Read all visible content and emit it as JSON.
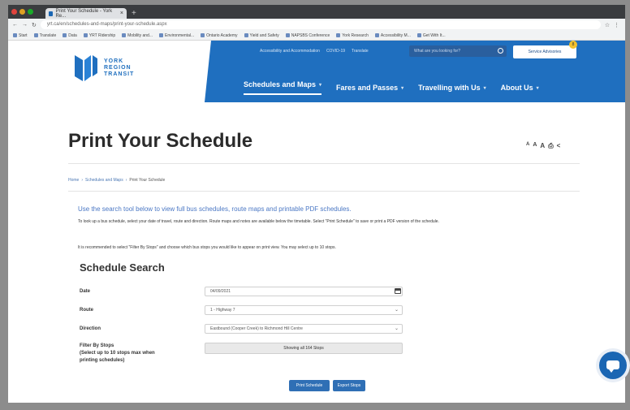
{
  "browser": {
    "tab_title": "Print Your Schedule - York Re...",
    "url": "yrt.ca/en/schedules-and-maps/print-your-schedule.aspx",
    "bookmarks": [
      "Start",
      "Translate",
      "Data",
      "YRT Ridership",
      "Mobility and...",
      "Environmental...",
      "Ontario Academy",
      "Yield and Safety",
      "NAPSBS Conference",
      "York Research",
      "Accessibility M...",
      "Get With It..."
    ]
  },
  "header": {
    "logo_lines": [
      "YORK",
      "REGION",
      "TRANSIT"
    ],
    "utility_links": [
      "Accessibility and Accommodation",
      "COVID-19",
      "Translate"
    ],
    "search_placeholder": "What are you looking for?",
    "service_button": "Service Advisories",
    "service_badge": "8",
    "nav": [
      {
        "label": "Schedules and Maps"
      },
      {
        "label": "Fares and Passes"
      },
      {
        "label": "Travelling with Us"
      },
      {
        "label": "About Us"
      }
    ]
  },
  "page": {
    "title": "Print Your Schedule",
    "tools": [
      "A",
      "A",
      "A",
      "⎙",
      "<"
    ],
    "breadcrumb": [
      "Home",
      "Schedules and Maps",
      "Print Your Schedule"
    ],
    "intro": "Use the search tool below to view full bus schedules, route maps and printable PDF schedules.",
    "para1": "To look up a bus schedule, select your date of travel, route and direction. Route maps and notes are available below the timetable. Select \"Print Schedule\" to save or print a PDF version of the schedule.",
    "para2": "It is recommended to select \"Filter By Stops\" and choose which bus stops you would like to appear on print view. You may select up to 10 stops.",
    "section_title": "Schedule Search"
  },
  "form": {
    "date_label": "Date",
    "date_value": "04/09/2021",
    "route_label": "Route",
    "route_value": "1 - Highway 7",
    "direction_label": "Direction",
    "direction_value": "Eastbound (Cooper Creek) to Richmond Hill Centre",
    "filter_label_lines": [
      "Filter By Stops",
      "(Select up to 10 stops max when",
      "printing schedules)"
    ],
    "filter_button": "Showing all 164 Stops",
    "print_button": "Print Schedule",
    "export_button": "Export Stops"
  },
  "colors": {
    "brand_blue": "#1f6fbf",
    "button_blue": "#2f6fb5",
    "badge_yellow": "#f2c12e"
  }
}
